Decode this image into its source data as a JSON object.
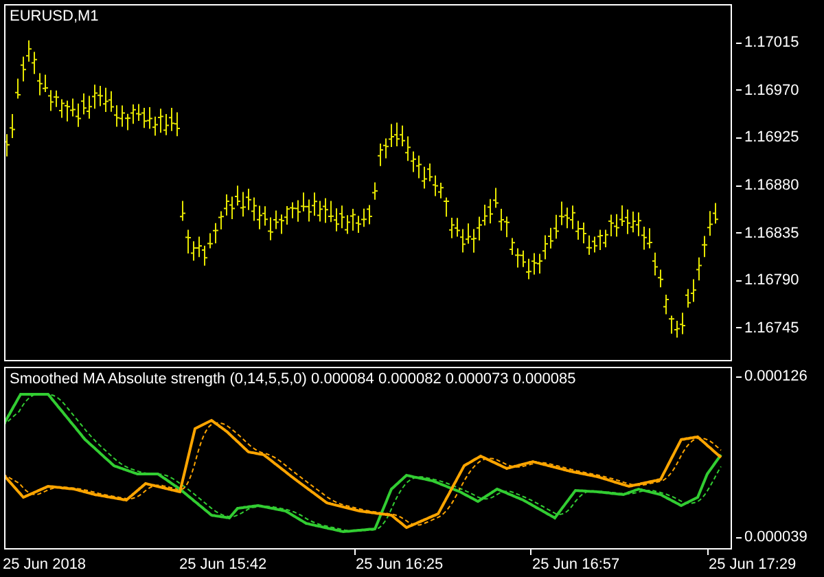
{
  "price_chart": {
    "symbol": "EURUSD,M1",
    "price_labels": [
      "1.17015",
      "1.16970",
      "1.16925",
      "1.16880",
      "1.16835",
      "1.16790",
      "1.16745"
    ]
  },
  "indicator": {
    "title": "Smoothed MA Absolute strength (0,14,5,5,0) 0.000084 0.000082 0.000073 0.000085",
    "scale_labels": [
      "0.000126",
      "0.000039"
    ]
  },
  "time_labels": [
    "25 Jun 2018",
    "25 Jun 15:42",
    "25 Jun 16:25",
    "25 Jun 16:57",
    "25 Jun 17:29"
  ]
}
